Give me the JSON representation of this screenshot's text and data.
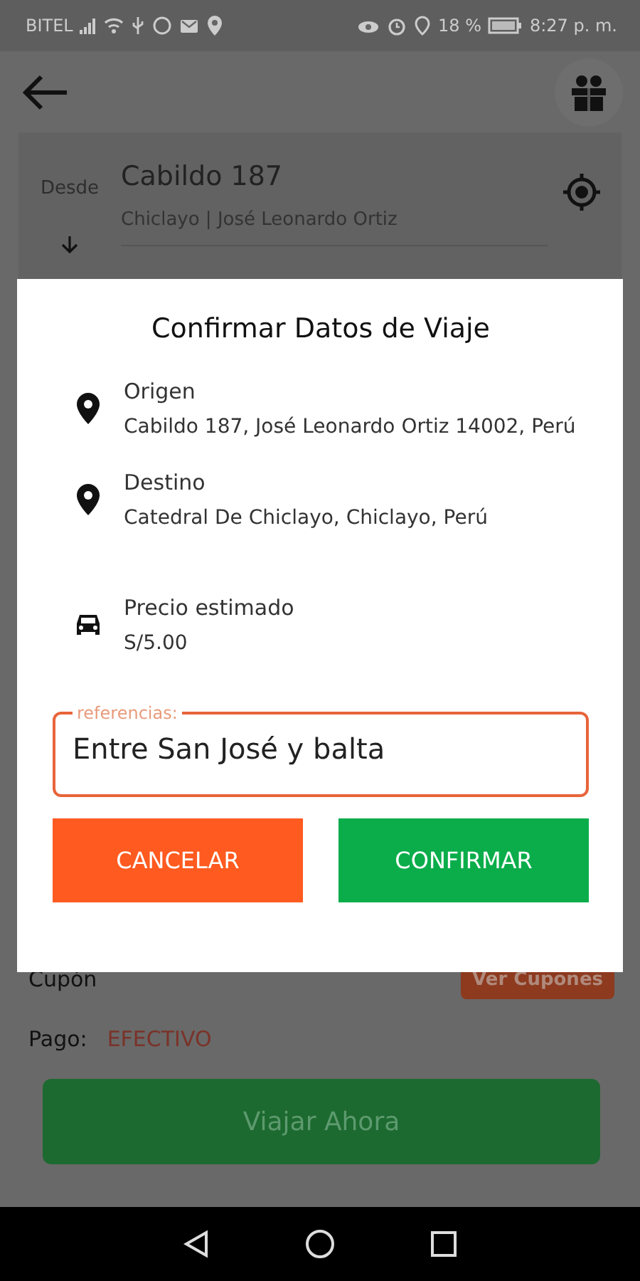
{
  "status_bar": {
    "carrier": "BITEL",
    "battery": "18 %",
    "time": "8:27 p. m."
  },
  "trip_card": {
    "label": "Desde",
    "address": "Cabildo 187",
    "subtitle": "Chiclayo | José Leonardo Ortiz"
  },
  "coupon": {
    "label": "Cupón",
    "button": "Ver Cupones"
  },
  "payment": {
    "label": "Pago:",
    "method": "EFECTIVO"
  },
  "primary_button": "Viajar Ahora",
  "dialog": {
    "title": "Confirmar Datos de Viaje",
    "items": [
      {
        "kind": "location",
        "label": "Origen",
        "value": "Cabildo 187, José Leonardo Ortiz 14002, Perú"
      },
      {
        "kind": "location",
        "label": "Destino",
        "value": "Catedral De Chiclayo, Chiclayo, Perú"
      },
      {
        "kind": "price",
        "label": "Precio estimado",
        "value": "S/5.00"
      }
    ],
    "reference_field": {
      "label": "referencias:",
      "value": "Entre San José y balta"
    },
    "buttons": [
      {
        "kind": "cancel",
        "label": "CANCELAR"
      },
      {
        "kind": "confirm",
        "label": "CONFIRMAR"
      }
    ]
  }
}
